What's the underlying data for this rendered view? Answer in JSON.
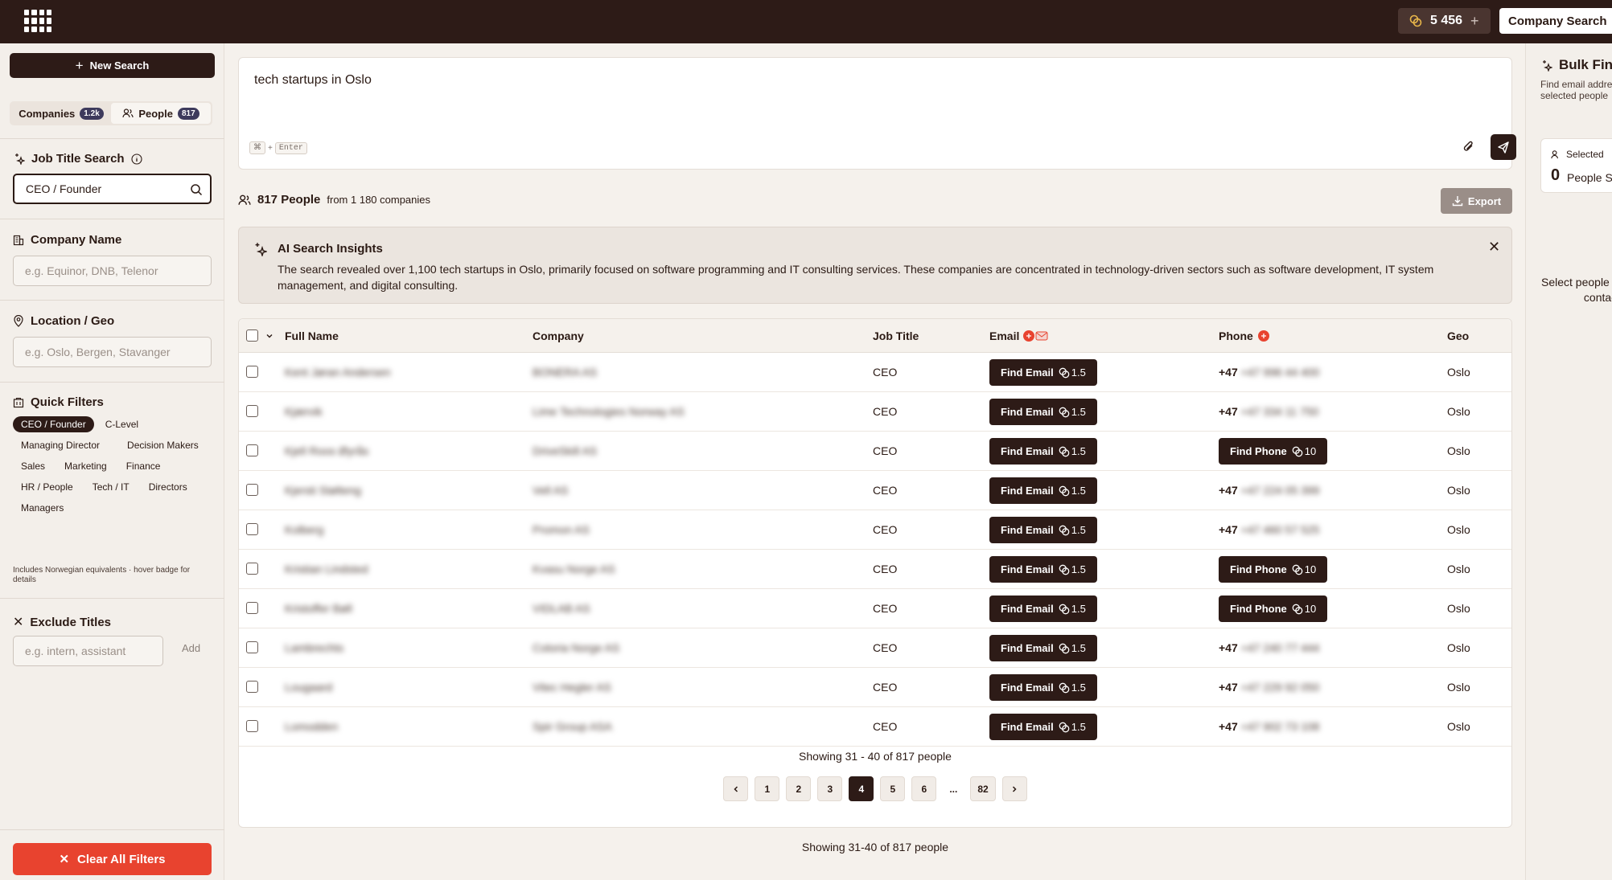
{
  "topbar": {
    "credits": "5 456",
    "company_search_label": "Company Search"
  },
  "sidebar": {
    "new_search_label": "New Search",
    "tabs": [
      {
        "label": "Companies",
        "badge": "1.2k"
      },
      {
        "label": "People",
        "badge": "817"
      }
    ],
    "job_title": {
      "title": "Job Title Search",
      "value": "CEO / Founder"
    },
    "company_name": {
      "title": "Company Name",
      "placeholder": "e.g. Equinor, DNB, Telenor"
    },
    "location": {
      "title": "Location / Geo",
      "placeholder": "e.g. Oslo, Bergen, Stavanger"
    },
    "quick_filters": {
      "title": "Quick Filters",
      "chips": [
        "CEO / Founder",
        "C-Level",
        "Managing Director",
        "Decision Makers",
        "Sales",
        "Marketing",
        "Finance",
        "HR / People",
        "Tech / IT",
        "Directors",
        "Managers"
      ],
      "note": "Includes Norwegian equivalents · hover badge for details"
    },
    "exclude": {
      "title": "Exclude Titles",
      "placeholder": "e.g. intern, assistant",
      "add_label": "Add"
    },
    "clear_label": "Clear All Filters"
  },
  "main": {
    "query": "tech startups in Oslo",
    "kbd_key": "Enter",
    "people_count": "817 People",
    "from_companies": "from 1 180 companies",
    "export_label": "Export",
    "insights": {
      "title": "AI Search Insights",
      "text": "The search revealed over 1,100 tech startups in Oslo, primarily focused on software programming and IT consulting services. These companies are concentrated in technology-driven sectors such as software development, IT system management, and digital consulting."
    },
    "table": {
      "headers": {
        "name": "Full Name",
        "company": "Company",
        "job": "Job Title",
        "email": "Email",
        "phone": "Phone",
        "geo": "Geo"
      },
      "find_email_label": "Find Email",
      "find_email_cost": "1.5",
      "find_phone_label": "Find Phone",
      "find_phone_cost": "10",
      "rows": [
        {
          "name": "Kent Jøran Andersen",
          "company": "BONERA AS",
          "job": "CEO",
          "phone": "+47 996 44 400",
          "geo": "Oslo"
        },
        {
          "name": "Kjærvik",
          "company": "Lime Technologies Norway AS",
          "job": "CEO",
          "phone": "+47 334 11 750",
          "geo": "Oslo"
        },
        {
          "name": "Kjell Roos Øyrås",
          "company": "DriveSkill AS",
          "job": "CEO",
          "phone": "",
          "geo": "Oslo"
        },
        {
          "name": "Kjersti Stølteng",
          "company": "Vell AS",
          "job": "CEO",
          "phone": "+47 224 05 399",
          "geo": "Oslo"
        },
        {
          "name": "Kolberg",
          "company": "Promon AS",
          "job": "CEO",
          "phone": "+47 460 57 525",
          "geo": "Oslo"
        },
        {
          "name": "Kristian Lindsted",
          "company": "Kvasu Norge AS",
          "job": "CEO",
          "phone": "",
          "geo": "Oslo"
        },
        {
          "name": "Kristoffer Bøll",
          "company": "VIDLAB AS",
          "job": "CEO",
          "phone": "",
          "geo": "Oslo"
        },
        {
          "name": "Lambrechts",
          "company": "Coloria Norge AS",
          "job": "CEO",
          "phone": "+47 240 77 444",
          "geo": "Oslo"
        },
        {
          "name": "Lougaard",
          "company": "Vitec Hegler AS",
          "job": "CEO",
          "phone": "+47 229 92 050",
          "geo": "Oslo"
        },
        {
          "name": "Lomodden",
          "company": "Spir Group ASA",
          "job": "CEO",
          "phone": "+47 902 73 108",
          "geo": "Oslo"
        }
      ]
    },
    "showing_top": "Showing 31 - 40 of 817 people",
    "pages": [
      "1",
      "2",
      "3",
      "4",
      "5",
      "6",
      "...",
      "82"
    ],
    "showing_bottom": "Showing 31-40 of 817 people"
  },
  "right_panel": {
    "title": "Bulk Find",
    "subtitle": "Find email addresses for selected people",
    "selected_label": "Selected",
    "selected_count": "0",
    "selected_unit": "People Selected",
    "hint": "Select people to find their contacts"
  }
}
